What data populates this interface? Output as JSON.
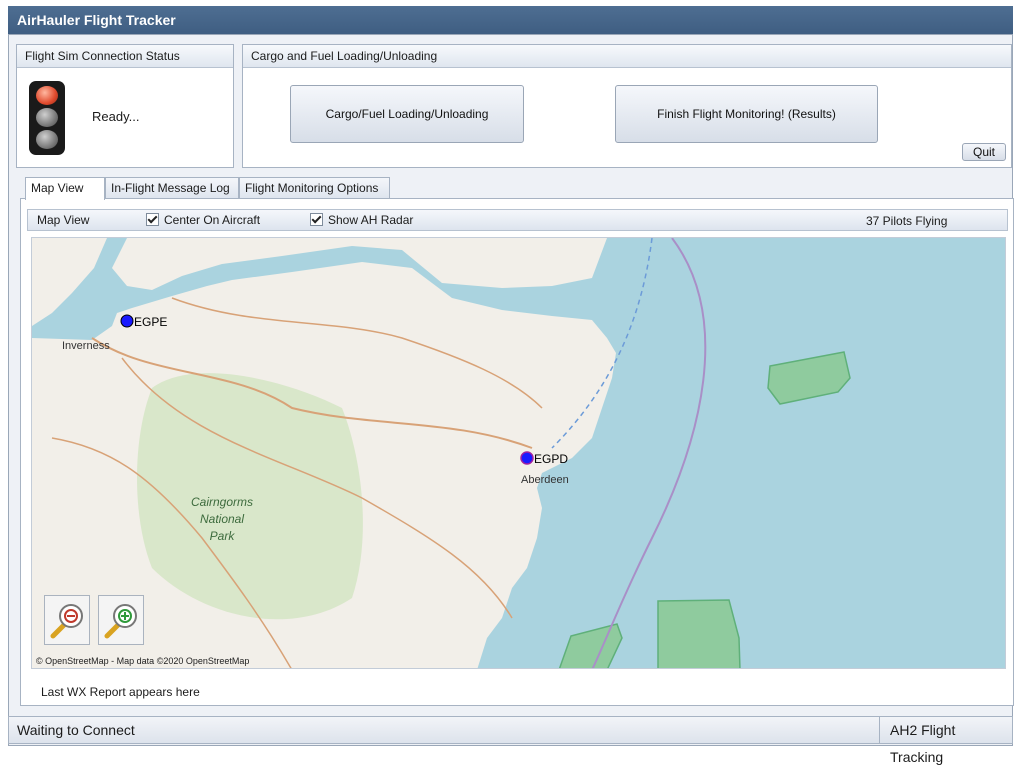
{
  "window": {
    "title": "AirHauler Flight Tracker"
  },
  "connection": {
    "header": "Flight Sim Connection Status",
    "status_text": "Ready..."
  },
  "cargo": {
    "header": "Cargo and Fuel Loading/Unloading",
    "loading_button": "Cargo/Fuel Loading/Unloading",
    "finish_button": "Finish Flight Monitoring! (Results)",
    "quit_button": "Quit"
  },
  "tabs": [
    "Map View",
    "In-Flight Message Log",
    "Flight Monitoring Options"
  ],
  "map_toolbar": {
    "title": "Map View",
    "center_on_aircraft": "Center On Aircraft",
    "center_checked": true,
    "show_radar": "Show AH Radar",
    "radar_checked": true,
    "pilots": "37 Pilots Flying"
  },
  "map": {
    "labels": {
      "egpe": "EGPE",
      "egpd": "EGPD",
      "inverness": "Inverness",
      "aberdeen": "Aberdeen",
      "park": [
        "Cairngorms",
        "National",
        "Park"
      ]
    },
    "attribution": "© OpenStreetMap - Map data ©2020 OpenStreetMap",
    "colors": {
      "sea": "#aad3df",
      "land": "#f2efe9",
      "park": "#d6e6c6",
      "marker": "#1a1aff"
    }
  },
  "wx_report": "Last WX Report appears here",
  "status": {
    "left": "Waiting to Connect",
    "right": "AH2 Flight Tracking"
  }
}
